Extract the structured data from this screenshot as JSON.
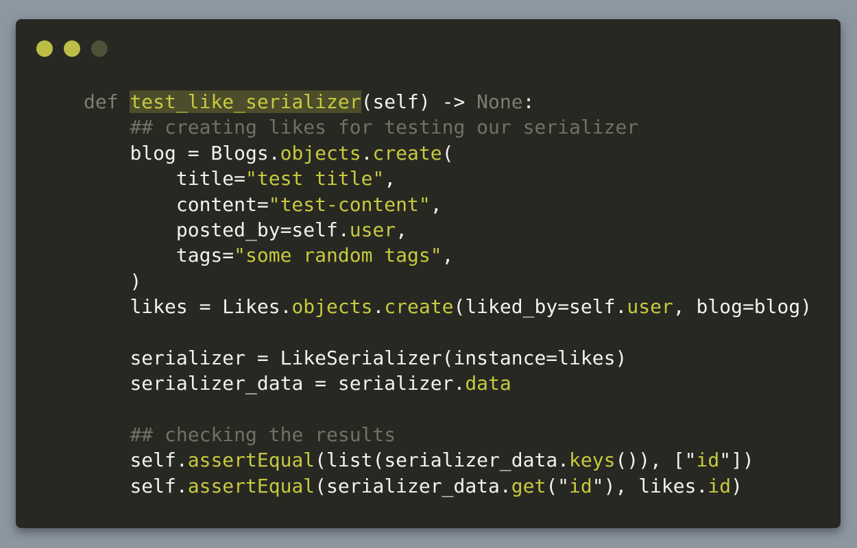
{
  "window": {
    "controls": [
      "close-dot",
      "minimize-dot",
      "maximize-dot"
    ],
    "colors": {
      "background": "#272822",
      "accent": "#c8c93f",
      "comment": "#6f7266",
      "text": "#f2f2ee"
    }
  },
  "code": {
    "lines": [
      [
        [
          "",
          "def ",
          "kw"
        ],
        [
          "",
          "test_like_serializer",
          "fn"
        ],
        [
          "",
          "(self) -> ",
          "w"
        ],
        [
          "",
          "None",
          "kw"
        ],
        [
          "",
          ":",
          "w"
        ]
      ],
      [
        [
          "    ",
          "## creating likes for testing our serializer",
          "cm"
        ]
      ],
      [
        [
          "    ",
          "blog = Blogs.",
          "w"
        ],
        [
          "",
          "objects",
          "y"
        ],
        [
          "",
          ".",
          "w"
        ],
        [
          "",
          "create",
          "y"
        ],
        [
          "",
          "(",
          "w"
        ]
      ],
      [
        [
          "        ",
          "title=",
          "w"
        ],
        [
          "",
          "\"test title\"",
          "y"
        ],
        [
          "",
          ",",
          "w"
        ]
      ],
      [
        [
          "        ",
          "content=",
          "w"
        ],
        [
          "",
          "\"test-content\"",
          "y"
        ],
        [
          "",
          ",",
          "w"
        ]
      ],
      [
        [
          "        ",
          "posted_by=self.",
          "w"
        ],
        [
          "",
          "user",
          "y"
        ],
        [
          "",
          ",",
          "w"
        ]
      ],
      [
        [
          "        ",
          "tags=",
          "w"
        ],
        [
          "",
          "\"some random tags\"",
          "y"
        ],
        [
          "",
          ",",
          "w"
        ]
      ],
      [
        [
          "    ",
          ")",
          "w"
        ]
      ],
      [
        [
          "    ",
          "likes = Likes.",
          "w"
        ],
        [
          "",
          "objects",
          "y"
        ],
        [
          "",
          ".",
          "w"
        ],
        [
          "",
          "create",
          "y"
        ],
        [
          "",
          "(liked_by=self.",
          "w"
        ],
        [
          "",
          "user",
          "y"
        ],
        [
          "",
          ", blog=blog)",
          "w"
        ]
      ],
      [],
      [
        [
          "    ",
          "serializer = LikeSerializer(instance=likes)",
          "w"
        ]
      ],
      [
        [
          "    ",
          "serializer_data = serializer.",
          "w"
        ],
        [
          "",
          "data",
          "y"
        ]
      ],
      [],
      [
        [
          "    ",
          "## checking the results",
          "cm"
        ]
      ],
      [
        [
          "    ",
          "self.",
          "w"
        ],
        [
          "",
          "assertEqual",
          "y"
        ],
        [
          "",
          "(list(serializer_data.",
          "w"
        ],
        [
          "",
          "keys",
          "y"
        ],
        [
          "",
          "()), [\"",
          "w"
        ],
        [
          "",
          "id",
          "y"
        ],
        [
          "",
          "\"])",
          "w"
        ]
      ],
      [
        [
          "    ",
          "self.",
          "w"
        ],
        [
          "",
          "assertEqual",
          "y"
        ],
        [
          "",
          "(serializer_data.",
          "w"
        ],
        [
          "",
          "get",
          "y"
        ],
        [
          "",
          "(\"",
          "w"
        ],
        [
          "",
          "id",
          "y"
        ],
        [
          "",
          "\"), likes.",
          "w"
        ],
        [
          "",
          "id",
          "y"
        ],
        [
          "",
          ")",
          "w"
        ]
      ]
    ]
  }
}
